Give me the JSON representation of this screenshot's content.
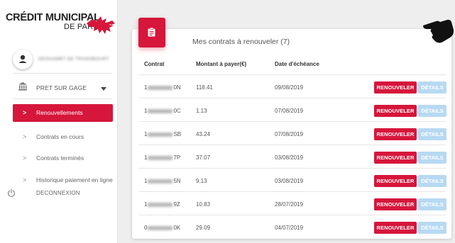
{
  "brand": {
    "line1": "CRÉDIT MUNICIPAL",
    "line2": "DE PARIS"
  },
  "user": {
    "name": "DESHAMBT DE TRANSBOURT"
  },
  "product": {
    "label": "PRET SUR GAGE"
  },
  "nav": {
    "items": [
      {
        "label": "Renouvellements",
        "active": true
      },
      {
        "label": "Contrats en cours",
        "active": false
      },
      {
        "label": "Contrats terminés",
        "active": false
      },
      {
        "label": "Historique paiement en ligne",
        "active": false
      }
    ],
    "logout_label": "DECONNEXION"
  },
  "card": {
    "title": "Mes contrats à renouveler (7)",
    "columns": [
      "Contrat",
      "Montant à payer(€)",
      "Date d'échéance"
    ],
    "renew_label": "RENOUVELER",
    "details_label": "DÉTAILS",
    "rows": [
      {
        "prefix": "1",
        "suffix": "0N",
        "amount": "118.41",
        "date": "09/08/2019"
      },
      {
        "prefix": "1",
        "suffix": "0C",
        "amount": "1.13",
        "date": "07/08/2019"
      },
      {
        "prefix": "1",
        "suffix": "SB",
        "amount": "43.24",
        "date": "07/08/2019"
      },
      {
        "prefix": "1",
        "suffix": "7P",
        "amount": "37.07",
        "date": "03/08/2019"
      },
      {
        "prefix": "1",
        "suffix": "5N",
        "amount": "9.13",
        "date": "03/08/2019"
      },
      {
        "prefix": "1",
        "suffix": "9Z",
        "amount": "10.83",
        "date": "28/07/2019"
      },
      {
        "prefix": "0",
        "suffix": "0K",
        "amount": "29.09",
        "date": "04/07/2019"
      }
    ]
  },
  "colors": {
    "accent": "#d6163b",
    "details": "#b7d9f2",
    "background": "#eeeeee"
  }
}
